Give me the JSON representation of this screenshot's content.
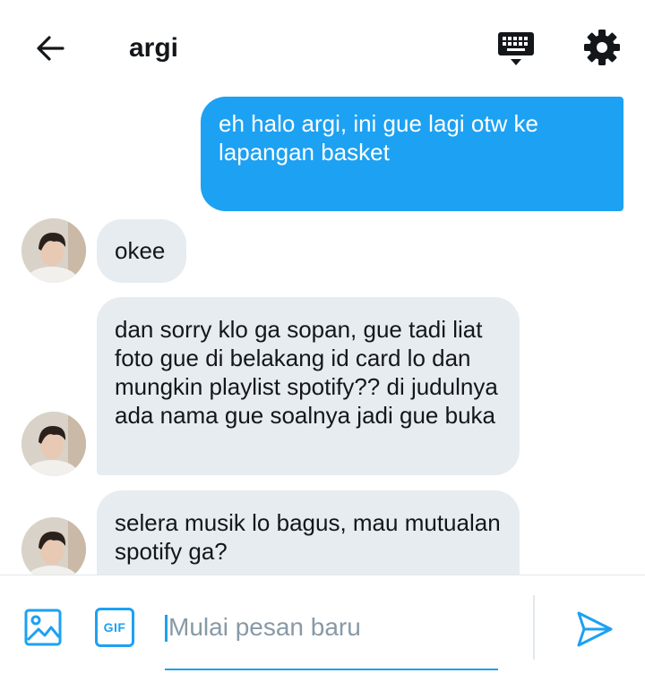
{
  "header": {
    "title": "argi",
    "icons": {
      "back": "arrow-left-icon",
      "keyboard": "keyboard-icon",
      "settings": "gear-icon"
    }
  },
  "messages": [
    {
      "direction": "outgoing",
      "text": "eh halo argi, ini gue lagi otw ke lapangan basket"
    },
    {
      "direction": "incoming",
      "text": "okee"
    },
    {
      "direction": "incoming",
      "text": "dan sorry klo ga sopan, gue tadi liat foto gue di belakang id card lo dan mungkin playlist spotify?? di judulnya ada nama gue soalnya jadi gue buka"
    },
    {
      "direction": "incoming",
      "text": "selera musik lo bagus, mau mutualan spotify ga?"
    }
  ],
  "composer": {
    "placeholder": "Mulai pesan baru",
    "gif_label": "GIF",
    "icons": {
      "media": "image-icon",
      "gif": "gif-icon",
      "send": "send-icon"
    }
  },
  "colors": {
    "accent": "#1da1f2",
    "incoming_bubble": "#e6ecf0",
    "text": "#14171a",
    "placeholder": "#8899a6"
  }
}
